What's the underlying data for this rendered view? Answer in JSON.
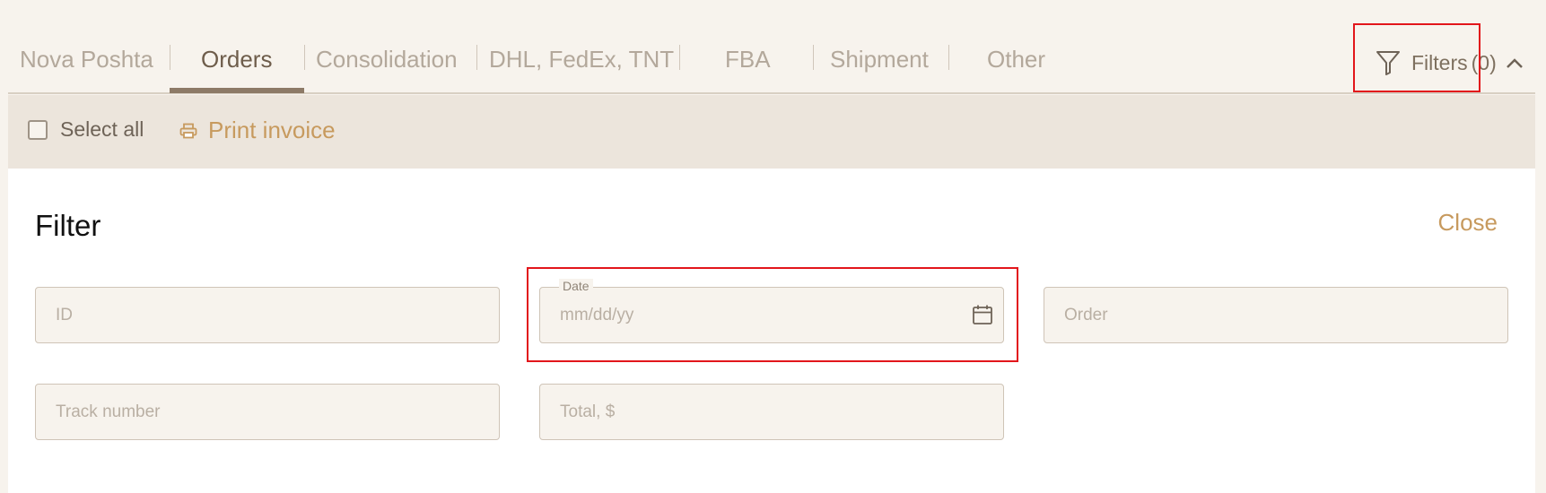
{
  "tabs": [
    {
      "label": "Nova Poshta",
      "active": false
    },
    {
      "label": "Orders",
      "active": true
    },
    {
      "label": "Consolidation",
      "active": false
    },
    {
      "label": "DHL, FedEx, TNT",
      "active": false
    },
    {
      "label": "FBA",
      "active": false
    },
    {
      "label": "Shipment",
      "active": false
    },
    {
      "label": "Other",
      "active": false
    }
  ],
  "filters_toggle": {
    "label": "Filters",
    "count": "(0)"
  },
  "toolbar": {
    "select_all_label": "Select all",
    "print_invoice_label": "Print invoice"
  },
  "filter_panel": {
    "title": "Filter",
    "close_label": "Close",
    "fields": {
      "id_placeholder": "ID",
      "date_label": "Date",
      "date_placeholder": "mm/dd/yy",
      "order_placeholder": "Order",
      "track_placeholder": "Track number",
      "total_placeholder": "Total, $"
    }
  },
  "colors": {
    "accent": "#c79a5e",
    "highlight": "#e2161b",
    "active_tab_underline": "#8d7a67"
  }
}
